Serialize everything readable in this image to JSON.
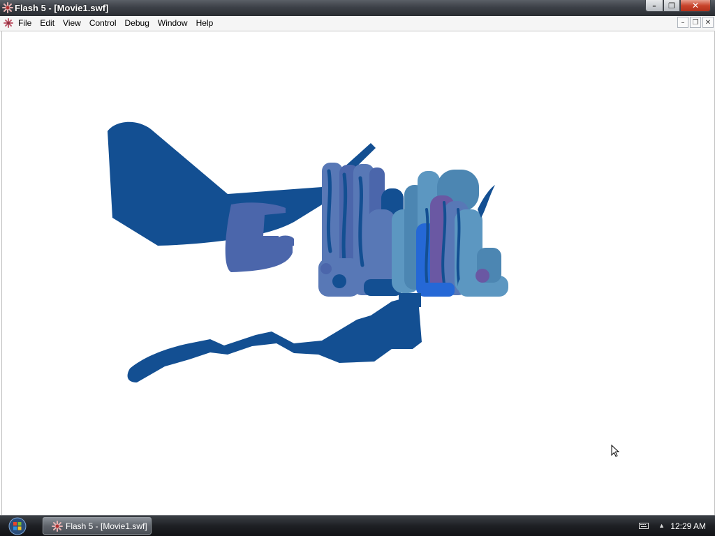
{
  "window": {
    "title": "Flash 5 - [Movie1.swf]",
    "controls": {
      "minimize": "–",
      "maximize": "❐",
      "close": "✕"
    }
  },
  "menubar": {
    "items": [
      "File",
      "Edit",
      "View",
      "Control",
      "Debug",
      "Window",
      "Help"
    ],
    "mdi_controls": {
      "minimize": "–",
      "restore": "❐",
      "close": "✕"
    }
  },
  "stage": {
    "background": "#ffffff",
    "palette": {
      "dark_blue": "#134f92",
      "medium_blue": "#4b66ab",
      "slate_blue": "#5878b6",
      "teal_blue": "#4c86b2",
      "light_teal": "#5c97c1",
      "bright_blue": "#2568d6",
      "purple": "#6a58a3"
    }
  },
  "taskbar": {
    "start_icon": "windows-start-orb-icon",
    "task_button_label": "Flash 5 - [Movie1.swf]",
    "tray": {
      "keyboard_icon": "keyboard-icon",
      "show_hidden_icon": "up-arrow-icon",
      "clock": "12:29 AM"
    }
  },
  "colors": {
    "titlebar": "#3d4148",
    "taskbar": "#1e2024",
    "close_button": "#c8442c"
  }
}
